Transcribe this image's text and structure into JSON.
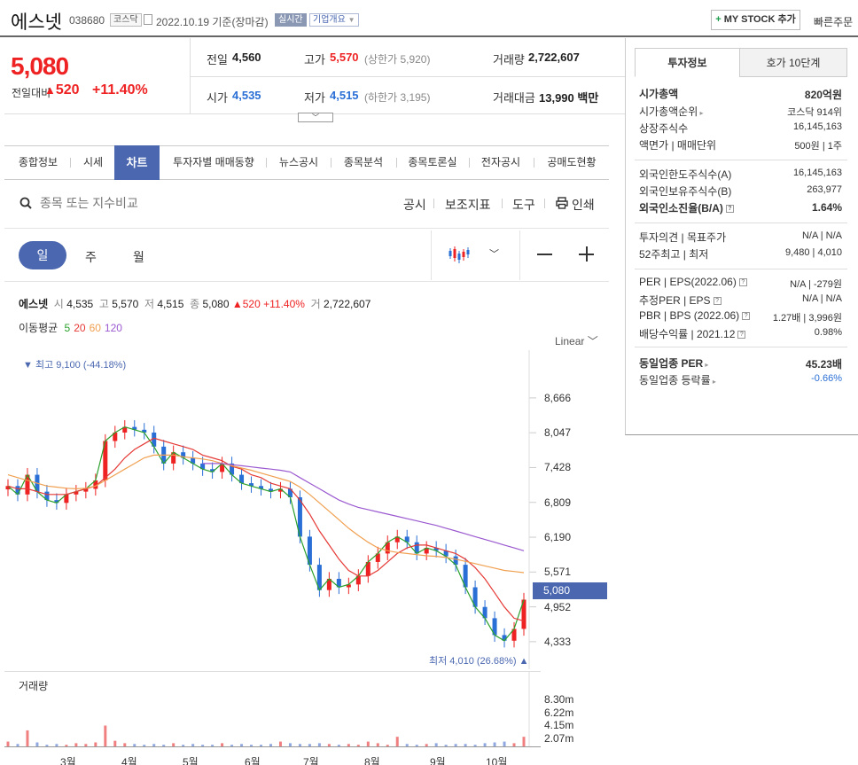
{
  "header": {
    "stock_name": "에스넷",
    "stock_code": "038680",
    "market": "코스닥",
    "base_date": "2022.10.19 기준(장마감)",
    "realtime": "실시간",
    "company_info": "기업개요",
    "mystock_label": "MY STOCK 추가",
    "quick_order": "빠른주문"
  },
  "price": {
    "current": "5,080",
    "change_label": "전일대비",
    "change_amount": "520",
    "change_pct": "+11.40%",
    "prev_close_label": "전일",
    "prev_close": "4,560",
    "high_label": "고가",
    "high": "5,570",
    "upper_limit": "(상한가 5,920)",
    "volume_label": "거래량",
    "volume": "2,722,607",
    "open_label": "시가",
    "open": "4,535",
    "low_label": "저가",
    "low": "4,515",
    "lower_limit": "(하한가 3,195)",
    "amount_label": "거래대금",
    "amount": "13,990 백만"
  },
  "tabs": [
    "종합정보",
    "시세",
    "차트",
    "투자자별 매매동향",
    "뉴스공시",
    "종목분석",
    "종목토론실",
    "전자공시",
    "공매도현황"
  ],
  "toolbar": {
    "search_placeholder": "종목 또는 지수비교",
    "disclosure": "공시",
    "indicator": "보조지표",
    "tools": "도구",
    "print": "인쇄"
  },
  "periods": [
    "일",
    "주",
    "월"
  ],
  "chart_info": {
    "name": "에스넷",
    "open_l": "시",
    "open": "4,535",
    "high_l": "고",
    "high": "5,570",
    "low_l": "저",
    "low": "4,515",
    "close_l": "종",
    "close": "5,080",
    "change": "520",
    "pct": "+11.40%",
    "vol_l": "거",
    "vol": "2,722,607",
    "ma_label": "이동평균",
    "ma": [
      {
        "label": "5",
        "color": "#2ca02c"
      },
      {
        "label": "20",
        "color": "#e53935"
      },
      {
        "label": "60",
        "color": "#f0a050"
      },
      {
        "label": "120",
        "color": "#9b59d0"
      }
    ],
    "scale": "Linear",
    "high_note": "최고 9,100 (-44.18%)",
    "low_note": "최저 4,010 (26.68%)",
    "current_tag": "5,080",
    "volume_title": "거래량"
  },
  "chart_data": {
    "type": "candlestick",
    "y_ticks": [
      "8,666",
      "8,047",
      "7,428",
      "6,809",
      "6,190",
      "5,571",
      "4,952",
      "4,333"
    ],
    "volume_ticks": [
      "8.30m",
      "6.22m",
      "4.15m",
      "2.07m"
    ],
    "months": [
      "3월",
      "4월",
      "5월",
      "6월",
      "7월",
      "8월",
      "9월",
      "10월"
    ],
    "ylim": [
      4000,
      9200
    ],
    "close_series": [
      7100,
      6950,
      7300,
      7000,
      6850,
      6800,
      6950,
      7000,
      7050,
      7200,
      7900,
      8050,
      8150,
      8100,
      8050,
      7800,
      7500,
      7700,
      7600,
      7500,
      7400,
      7350,
      7500,
      7300,
      7150,
      7100,
      7050,
      7000,
      7050,
      6900,
      6200,
      5700,
      5250,
      5450,
      5300,
      5350,
      5500,
      5750,
      5900,
      6100,
      6200,
      6100,
      5900,
      6000,
      5950,
      5850,
      5700,
      5300,
      4950,
      4750,
      4450,
      4350,
      4560,
      5080
    ],
    "ma20": [
      7100,
      7050,
      7050,
      7000,
      6950,
      6950,
      6950,
      7000,
      7050,
      7100,
      7250,
      7400,
      7600,
      7750,
      7850,
      7950,
      7900,
      7850,
      7800,
      7750,
      7650,
      7600,
      7550,
      7450,
      7400,
      7300,
      7250,
      7150,
      7100,
      7050,
      6850,
      6600,
      6300,
      6050,
      5800,
      5600,
      5500,
      5500,
      5600,
      5750,
      5900,
      6000,
      6050,
      6050,
      6000,
      5950,
      5900,
      5800,
      5650,
      5450,
      5200,
      4950,
      4750,
      4700
    ],
    "ma60": [
      7300,
      7250,
      7200,
      7150,
      7100,
      7080,
      7060,
      7050,
      7060,
      7100,
      7200,
      7300,
      7400,
      7500,
      7600,
      7650,
      7650,
      7650,
      7620,
      7600,
      7580,
      7550,
      7500,
      7460,
      7420,
      7380,
      7330,
      7280,
      7230,
      7180,
      7080,
      6950,
      6800,
      6650,
      6500,
      6350,
      6220,
      6100,
      6000,
      5950,
      5920,
      5900,
      5880,
      5860,
      5850,
      5830,
      5800,
      5760,
      5720,
      5680,
      5640,
      5600,
      5580,
      5560
    ],
    "ma120": [
      null,
      null,
      null,
      null,
      null,
      null,
      null,
      null,
      null,
      null,
      null,
      null,
      null,
      null,
      null,
      null,
      null,
      null,
      null,
      null,
      7500,
      7500,
      7500,
      7480,
      7460,
      7440,
      7420,
      7400,
      7380,
      7350,
      7250,
      7150,
      7050,
      6950,
      6850,
      6780,
      6720,
      6680,
      6640,
      6600,
      6560,
      6520,
      6480,
      6440,
      6400,
      6350,
      6300,
      6250,
      6200,
      6150,
      6100,
      6050,
      6000,
      5950
    ],
    "volume": [
      0.6,
      0.3,
      2.0,
      0.5,
      0.2,
      0.3,
      0.2,
      0.4,
      0.3,
      0.5,
      2.6,
      0.7,
      0.4,
      0.3,
      0.2,
      0.3,
      0.2,
      0.4,
      0.2,
      0.3,
      0.2,
      0.2,
      0.4,
      0.2,
      0.3,
      0.2,
      0.2,
      0.3,
      0.6,
      0.4,
      0.3,
      0.3,
      0.4,
      0.3,
      0.2,
      0.3,
      0.2,
      0.6,
      0.4,
      0.2,
      1.2,
      0.3,
      0.2,
      0.3,
      0.4,
      0.2,
      0.3,
      0.3,
      0.2,
      0.4,
      0.5,
      0.6,
      0.4,
      1.2
    ],
    "series": [
      {
        "name": "5",
        "values_key": "close_series"
      },
      {
        "name": "20",
        "values_key": "ma20"
      },
      {
        "name": "60",
        "values_key": "ma60"
      },
      {
        "name": "120",
        "values_key": "ma120"
      }
    ]
  },
  "right": {
    "tab_info": "투자정보",
    "tab_quote": "호가 10단계",
    "rows": [
      {
        "label": "시가총액",
        "value": "820억원",
        "bold": true
      },
      {
        "label": "시가총액순위",
        "value": "코스닥 914위"
      },
      {
        "label": "상장주식수",
        "value": "16,145,163"
      },
      {
        "label": "액면가 | 매매단위",
        "value": "500원 | 1주"
      },
      {
        "label": "외국인한도주식수(A)",
        "value": "16,145,163"
      },
      {
        "label": "외국인보유주식수(B)",
        "value": "263,977"
      },
      {
        "label": "외국인소진율(B/A)",
        "value": "1.64%",
        "bold": true
      },
      {
        "label": "투자의견 | 목표주가",
        "value": "N/A | N/A"
      },
      {
        "label": "52주최고 | 최저",
        "value": "9,480 | 4,010"
      },
      {
        "label": "PER | EPS(2022.06)",
        "value": "N/A | -279원"
      },
      {
        "label": "추정PER | EPS",
        "value": "N/A | N/A"
      },
      {
        "label": "PBR | BPS (2022.06)",
        "value": "1.27배 | 3,996원"
      },
      {
        "label": "배당수익률 | 2021.12",
        "value": "0.98%"
      },
      {
        "label": "동일업종 PER",
        "value": "45.23배",
        "bold": true
      },
      {
        "label": "동일업종 등락률",
        "value": "-0.66%"
      }
    ],
    "colors": {
      "accent": "#4a67b0",
      "up": "#e22222",
      "down": "#2a6fd6"
    }
  }
}
